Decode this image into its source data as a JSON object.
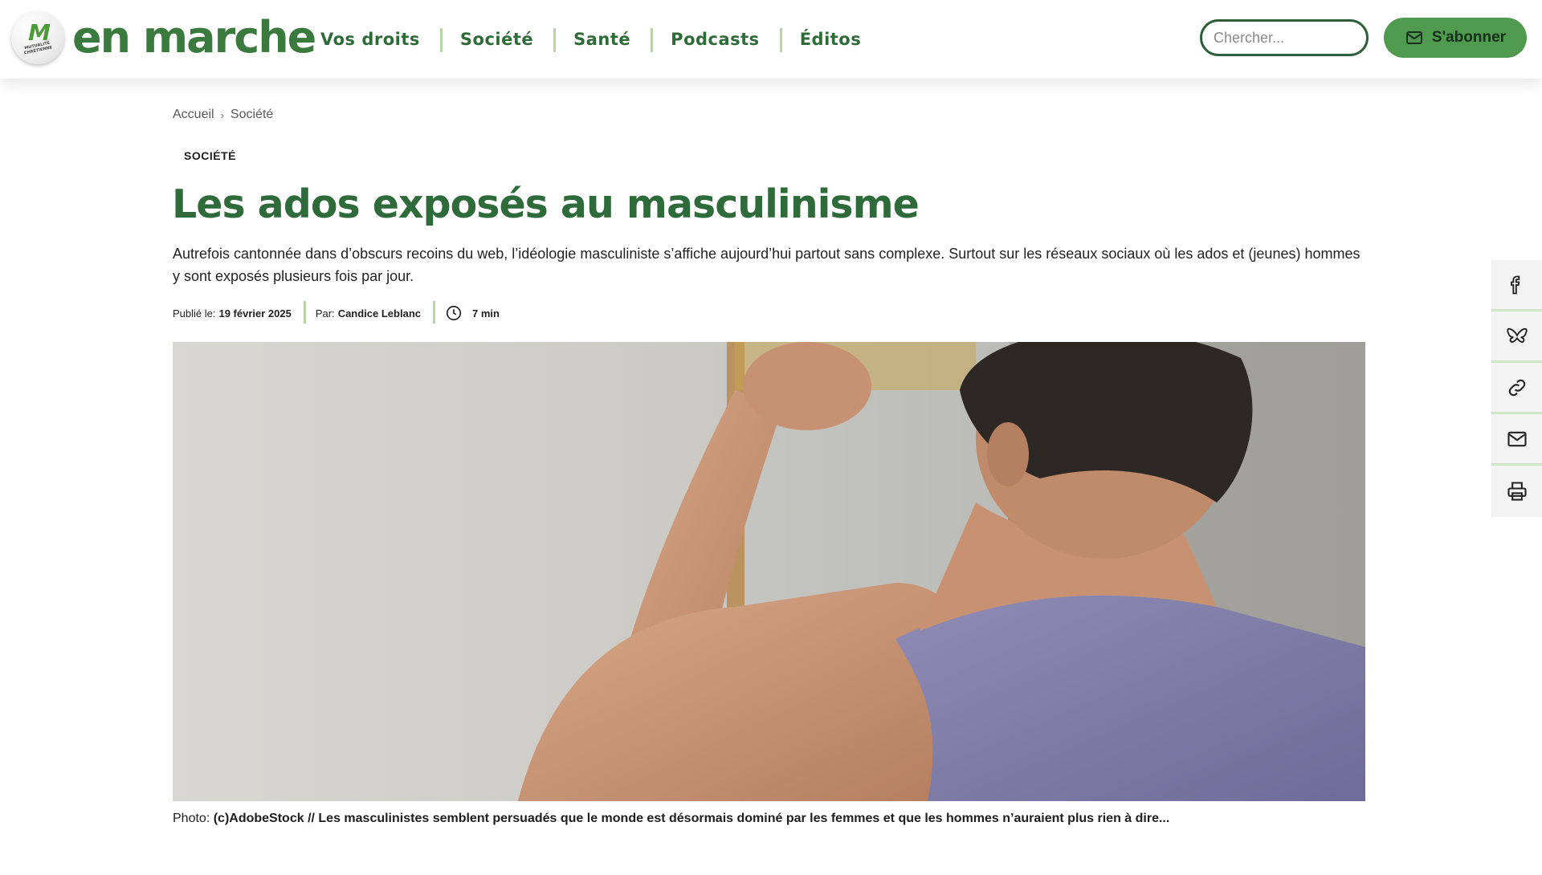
{
  "header": {
    "logo_mark": "M",
    "logo_badge_text": "MUTUALITÉ CHRÉTIENNE",
    "logo_text": "en marche",
    "nav": [
      {
        "label": "Vos droits"
      },
      {
        "label": "Société"
      },
      {
        "label": "Santé"
      },
      {
        "label": "Podcasts"
      },
      {
        "label": "Éditos"
      }
    ],
    "search_placeholder": "Chercher...",
    "subscribe_label": "S'abonner"
  },
  "breadcrumb": {
    "items": [
      "Accueil",
      "Société"
    ],
    "separator": "›"
  },
  "article": {
    "category": "SOCIÉTÉ",
    "title": "Les ados exposés au masculinisme",
    "lead": "Autrefois cantonnée dans d’obscurs recoins du web, l’idéologie masculiniste s’affiche aujourd’hui partout sans complexe. Surtout sur les réseaux sociaux où les ados et (jeunes) hommes y sont exposés plusieurs fois par jour.",
    "meta": {
      "published_label": "Publié le:",
      "published_date": "19 février 2025",
      "author_label": "Par:",
      "author": "Candice Leblanc",
      "read_time": "7 min"
    },
    "caption_label": "Photo:",
    "caption": "(c)AdobeStock // Les masculinistes semblent persuadés que le monde est désormais dominé par les femmes et que les hommes n’auraient plus rien à dire..."
  },
  "share": [
    {
      "icon": "facebook-icon"
    },
    {
      "icon": "bluesky-icon"
    },
    {
      "icon": "link-icon"
    },
    {
      "icon": "mail-icon"
    },
    {
      "icon": "print-icon"
    }
  ],
  "colors": {
    "brand_green": "#2f6a3b",
    "button_green": "#4f9a4f",
    "divider_green": "#b7d6a8"
  }
}
